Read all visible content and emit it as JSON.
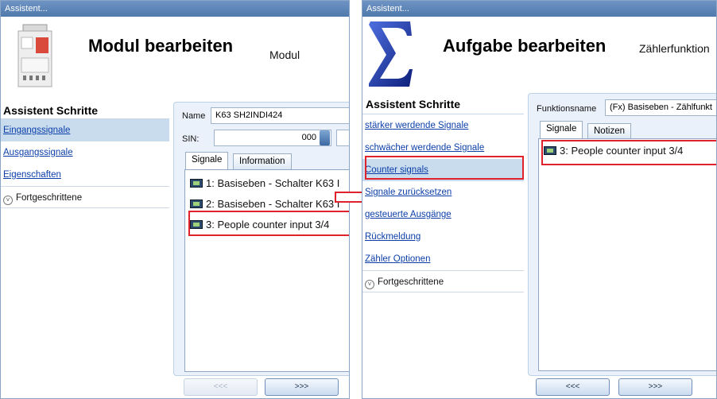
{
  "left": {
    "window_title": "Assistent...",
    "header_title": "Modul bearbeiten",
    "header_subtitle": "Modul",
    "steps_title": "Assistent Schritte",
    "steps": [
      "Eingangssignale",
      "Ausgangssignale",
      "Eigenschaften"
    ],
    "advanced": "Fortgeschrittene",
    "name_label": "Name",
    "name_value": "K63 SH2INDI424",
    "sin_label": "SIN:",
    "sin_value": "000",
    "tabs": [
      "Signale",
      "Information"
    ],
    "signals": [
      "1: Basiseben - Schalter K63 I",
      "2: Basiseben - Schalter K63 I",
      "3: People counter input 3/4"
    ],
    "prev_button": "<<<",
    "next_button": ">>>"
  },
  "right": {
    "window_title": "Assistent...",
    "header_title": "Aufgabe bearbeiten",
    "header_subtitle": "Zählerfunktion",
    "steps_title": "Assistent Schritte",
    "steps": [
      "stärker werdende Signale",
      "schwächer werdende Signale",
      "Counter signals",
      "Signale zurücksetzen",
      "gesteuerte Ausgänge",
      "Rückmeldung",
      "Zähler Optionen"
    ],
    "advanced": "Fortgeschrittene",
    "function_label": "Funktionsname",
    "function_value": "(Fx) Basiseben - Zählfunkt",
    "tabs": [
      "Signale",
      "Notizen"
    ],
    "signals": [
      "3: People counter input 3/4"
    ],
    "prev_button": "<<<",
    "next_button": ">>>"
  },
  "colors": {
    "highlight": "#e0222c",
    "link": "#0b3ea8",
    "selected_step": "#c9dcee",
    "titlebar": "#5a82b4"
  }
}
